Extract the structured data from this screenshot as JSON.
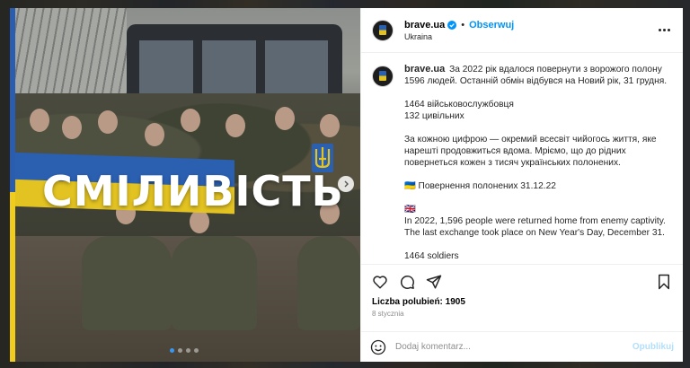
{
  "post": {
    "username": "brave.ua",
    "follow_label": "Obserwuj",
    "separator": "•",
    "location": "Ukraina",
    "image_title": "СМІЛИВІСТЬ",
    "caption": [
      "За 2022 рік вдалося повернути з ворожого полону 1596 людей. Останній обмін відбувся на Новий рік, 31 грудня.",
      "",
      "1464 військовослужбовця",
      "132 цивільних",
      "",
      "За кожною цифрою — окремий всесвіт чийогось життя, яке нарешті продовжиться вдома. Мріємо, що до рідних повернеться кожен з тисяч українських полонених.",
      "",
      "🇺🇦 Повернення полонених 31.12.22",
      "",
      "🇬🇧",
      "In 2022, 1,596 people were returned home from enemy captivity. The last exchange took place on New Year's Day, December 31.",
      "",
      "1464 soldiers"
    ],
    "likes_label": "Liczba polubień: 1905",
    "date": "8 stycznia",
    "comment_placeholder": "Dodaj komentarz...",
    "publish_label": "Opublikuj",
    "carousel": {
      "count": 4,
      "active": 0
    }
  },
  "icons": {
    "verified": "verified-badge-icon",
    "more": "more-options-icon",
    "like": "heart-icon",
    "comment": "comment-icon",
    "share": "share-icon",
    "save": "bookmark-icon",
    "emoji": "emoji-icon",
    "next": "chevron-right-icon"
  },
  "colors": {
    "link": "#0095f6",
    "publish_disabled": "#b2dffc",
    "flag_blue": "#2b5fb0",
    "flag_yellow": "#e3c322"
  }
}
